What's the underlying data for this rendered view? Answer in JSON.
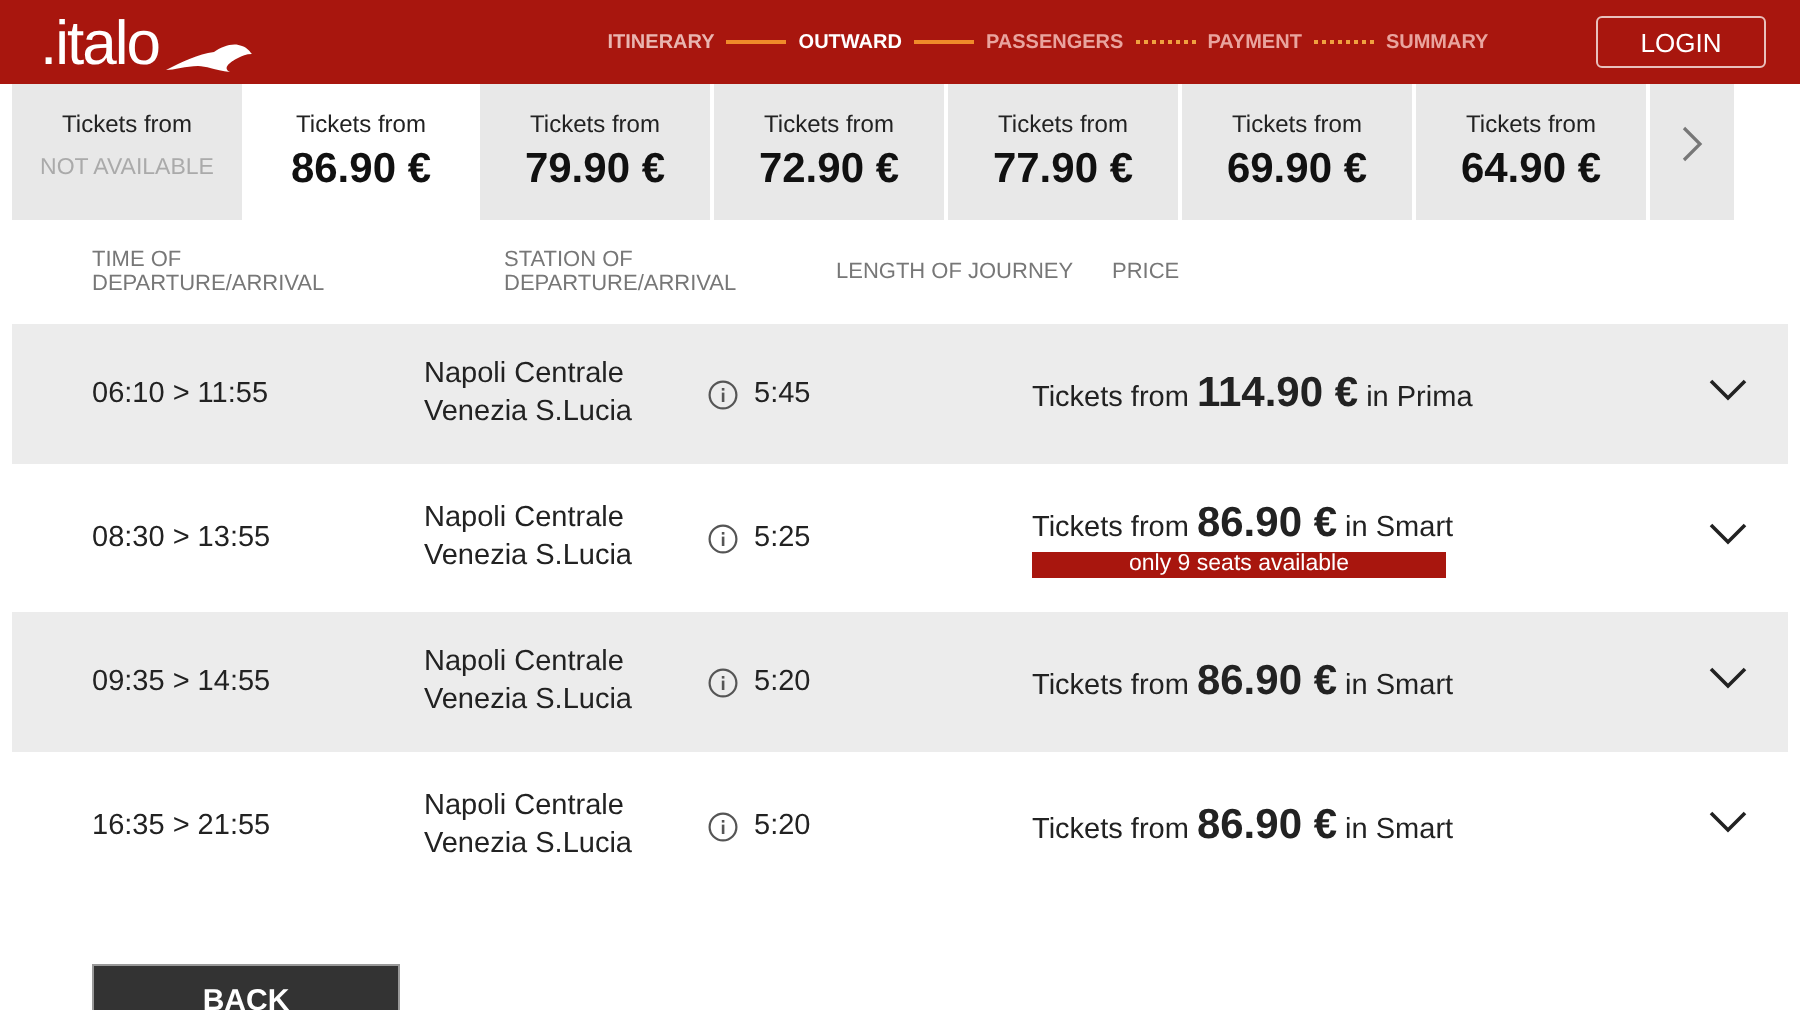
{
  "header": {
    "logo": ".italo",
    "login": "LOGIN",
    "steps": [
      {
        "label": "ITINERARY",
        "completed": true,
        "current": false
      },
      {
        "label": "OUTWARD",
        "completed": false,
        "current": true
      },
      {
        "label": "PASSENGERS",
        "completed": false,
        "current": false
      },
      {
        "label": "PAYMENT",
        "completed": false,
        "current": false
      },
      {
        "label": "SUMMARY",
        "completed": false,
        "current": false
      }
    ]
  },
  "dates": [
    {
      "label": "Tickets from",
      "price": "NOT AVAILABLE",
      "available": false,
      "selected": false
    },
    {
      "label": "Tickets from",
      "price": "86.90 €",
      "available": true,
      "selected": true
    },
    {
      "label": "Tickets from",
      "price": "79.90 €",
      "available": true,
      "selected": false
    },
    {
      "label": "Tickets from",
      "price": "72.90 €",
      "available": true,
      "selected": false
    },
    {
      "label": "Tickets from",
      "price": "77.90 €",
      "available": true,
      "selected": false
    },
    {
      "label": "Tickets from",
      "price": "69.90 €",
      "available": true,
      "selected": false
    },
    {
      "label": "Tickets from",
      "price": "64.90 €",
      "available": true,
      "selected": false
    }
  ],
  "table": {
    "columns": [
      "TIME OF DEPARTURE/ARRIVAL",
      "STATION OF DEPARTURE/ARRIVAL",
      "LENGTH OF JOURNEY",
      "PRICE"
    ],
    "rows": [
      {
        "time": "06:10 > 11:55",
        "from": "Napoli Centrale",
        "to": "Venezia S.Lucia",
        "duration": "5:45",
        "price": "Tickets from **114.90 €** in Prima"
      },
      {
        "time": "08:30 > 13:55",
        "from": "Napoli Centrale",
        "to": "Venezia S.Lucia",
        "duration": "5:25",
        "price": "Tickets from **86.90 €** in Smart",
        "notice": "only 9 seats available"
      },
      {
        "time": "09:35 > 14:55",
        "from": "Napoli Centrale",
        "to": "Venezia S.Lucia",
        "duration": "5:20",
        "price": "Tickets from **86.90 €** in Smart"
      },
      {
        "time": "16:35 > 21:55",
        "from": "Napoli Centrale",
        "to": "Venezia S.Lucia",
        "duration": "5:20",
        "price": "Tickets from **86.90 €** in Smart"
      }
    ]
  },
  "back": "BACK"
}
